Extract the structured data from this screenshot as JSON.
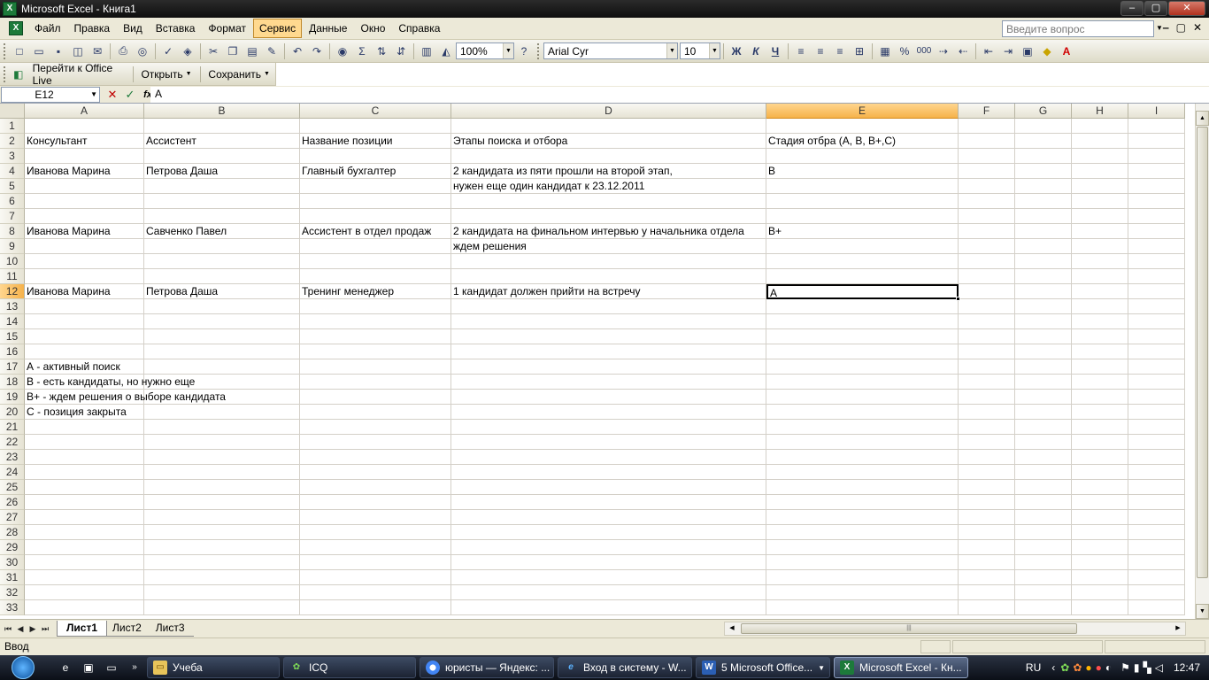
{
  "window": {
    "title": "Microsoft Excel - Книга1",
    "app_icon": "X",
    "controls": [
      "‒",
      "▢",
      "✕"
    ]
  },
  "menu": {
    "items": [
      "Файл",
      "Правка",
      "Вид",
      "Вставка",
      "Формат",
      "Сервис",
      "Данные",
      "Окно",
      "Справка"
    ],
    "active_index": 5,
    "help_placeholder": "Введите вопрос",
    "doc_controls": [
      "‒",
      "▢",
      "✕"
    ]
  },
  "toolbar": {
    "zoom": "100%",
    "font_name": "Arial Cyr",
    "font_size": "10",
    "bold": "Ж",
    "italic": "К",
    "underline": "Ч",
    "sum_icon": "Σ",
    "percent": "%",
    "thousands": "000"
  },
  "toolbar2": {
    "office_live": "Перейти к Office Live",
    "open": "Открыть",
    "save": "Сохранить"
  },
  "formula": {
    "name_box": "E12",
    "fx": "fx",
    "value": "A"
  },
  "grid": {
    "columns": [
      "A",
      "B",
      "C",
      "D",
      "E",
      "F",
      "G",
      "H",
      "I"
    ],
    "selected_column": "E",
    "selected_row": "12",
    "rows": [
      "1",
      "2",
      "3",
      "4",
      "5",
      "6",
      "7",
      "8",
      "9",
      "10",
      "11",
      "12",
      "13",
      "14",
      "15",
      "16",
      "17",
      "18",
      "19",
      "20",
      "21",
      "22",
      "23",
      "24",
      "25",
      "26",
      "27",
      "28",
      "29",
      "30",
      "31",
      "32",
      "33"
    ],
    "cells": {
      "A2": "Консультант",
      "B2": "Ассистент",
      "C2": "Название позиции",
      "D2": "Этапы поиска и отбора",
      "E2": "Стадия отбра (А, В, В+,С)",
      "A4": "Иванова Марина",
      "B4": "Петрова Даша",
      "C4": "Главный бухгалтер",
      "D4": "2 кандидата из пяти прошли на второй этап,",
      "D5": "нужен еще один кандидат к 23.12.2011",
      "E4": "В",
      "A8": "Иванова Марина",
      "B8": "Савченко Павел",
      "C8": "Ассистент в отдел продаж",
      "D8": "2 кандидата на финальном интервью у начальника отдела",
      "D9": "ждем решения",
      "E8": "В+",
      "A12": "Иванова Марина",
      "B12": "Петрова Даша",
      "C12": "Тренинг менеджер",
      "D12": "1 кандидат должен прийти на встречу",
      "E12": "А",
      "A17": "А - активный поиск",
      "A18": "В - есть кандидаты, но нужно еще",
      "A19": "В+ - ждем решения о выборе кандидата",
      "A20": "С - позиция закрыта"
    }
  },
  "sheets": {
    "tabs": [
      "Лист1",
      "Лист2",
      "Лист3"
    ],
    "active_index": 0
  },
  "status": {
    "mode": "Ввод"
  },
  "taskbar": {
    "buttons": [
      "Учеба",
      "ICQ",
      "юристы — Яндекс: ...",
      "Вход в систему - W...",
      "5 Microsoft Office...",
      "Microsoft Excel - Кн..."
    ],
    "active_index": 5,
    "language": "RU",
    "clock": "12:47"
  },
  "colors": {
    "selection_header": "#f6b24a",
    "active_menu": "#ffd98f",
    "excel_green": "#1d7a3a"
  }
}
